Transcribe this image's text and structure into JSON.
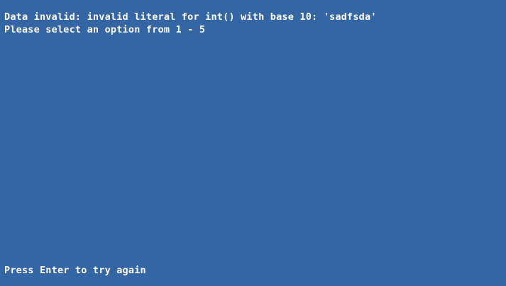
{
  "terminal": {
    "background": "#3465a4",
    "text_color": "#ffffff",
    "lines": [
      "Data invalid: invalid literal for int() with base 10: 'sadfsda'",
      "Please select an option from 1 - 5"
    ],
    "prompt": "Press Enter to try again"
  }
}
